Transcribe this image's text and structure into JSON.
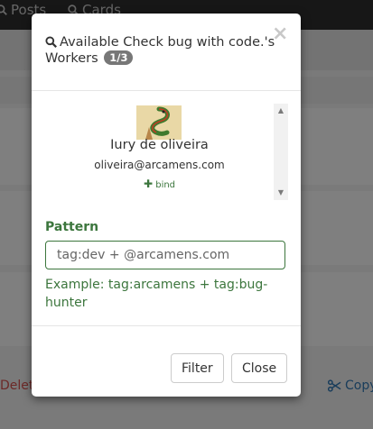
{
  "background": {
    "nav": [
      {
        "label": "Posts",
        "icon": "search-icon"
      },
      {
        "label": "Cards",
        "icon": "search-icon"
      }
    ],
    "footer_left": "Delet",
    "footer_right": "Copy",
    "footer_right_icon": "scissors-icon"
  },
  "modal": {
    "title": "Available Check bug with code.'s Workers",
    "title_icon": "search-icon",
    "count_badge": "1/3",
    "close_symbol": "×",
    "workers": [
      {
        "name": "Iury de oliveira",
        "email": "oliveira@arcamens.com",
        "action_label": "bind",
        "action_icon": "plus-icon"
      }
    ],
    "pattern": {
      "label": "Pattern",
      "placeholder": "tag:dev + @arcamens.com",
      "value": "",
      "help": "Example: tag:arcamens + tag:bug-hunter"
    },
    "buttons": {
      "filter": "Filter",
      "close": "Close"
    }
  },
  "colors": {
    "success_green": "#3c763d",
    "badge_gray": "#777777",
    "link_blue": "#337ab7"
  }
}
